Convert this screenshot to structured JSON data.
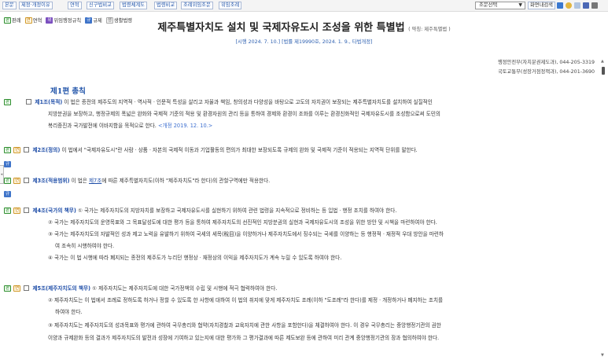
{
  "toolbar": {
    "buttons": [
      "본문",
      "제정·개정이유",
      "연혁",
      "신구법비교",
      "법령체계도",
      "법령비교",
      "조례위임조문",
      "위임조례"
    ],
    "select_value": "조문선택",
    "view_button": "화면내검색",
    "icons": [
      "download-icon",
      "bookmark-icon",
      "print-preview-icon",
      "save-icon",
      "print-icon"
    ],
    "colors": {
      "button_text": "#2255aa",
      "button_border": "#a9b9d6"
    }
  },
  "legend": {
    "items": [
      {
        "badge": "판",
        "label": "판례",
        "icon": "precedent-badge"
      },
      {
        "badge": "연",
        "label": "연혁",
        "icon": "history-badge"
      },
      {
        "badge": "위",
        "label": "위임행정규칙",
        "icon": "delegated-rule-badge"
      },
      {
        "badge": "규",
        "label": "규제",
        "icon": "regulation-badge"
      },
      {
        "badge": "생",
        "label": "생활법령",
        "icon": "living-law-badge"
      }
    ]
  },
  "law": {
    "title": "제주특별자치도 설치 및 국제자유도시 조성을 위한 특별법",
    "short_title": "( 약칭: 제주특별법 )",
    "enforcement": "[시행 2024. 7. 10.] [법률 제19990호, 2024. 1. 9., 타법개정]",
    "ministries": [
      "행정안전부(자치분권제도과), 044-205-3319",
      "국토교통부(성장거점정책과), 044-201-3690"
    ],
    "part": "제1편 총칙"
  },
  "articles": {
    "a1": {
      "head": "제1조(목적)",
      "text1": "이 법은 종전의 제주도의 지역적ㆍ역사적ㆍ인문적 특성을 살리고 자율과 책임, 창의성과 다양성을 바탕으로 고도의 자치권이 보장되는 제주특별자치도를 설치하여 실질적인",
      "text2": "지방분권을 보장하고, 행정규제의 폭넓은 완화와 국제적 기준의 적용 및 환경자원의 관리 등을 통하여 경제와 환경이 조화를 이루는 환경친화적인 국제자유도시를 조성함으로써 도민의",
      "text3": "복리증진과 국가발전에 이바지함을 목적으로 한다.",
      "amend": "<개정 2019. 12. 10.>"
    },
    "a2": {
      "head": "제2조(정의)",
      "text": "이 법에서 \"국제자유도시\"란 사람ㆍ상품ㆍ자본의 국제적 이동과 기업활동의 편의가 최대한 보장되도록 규제의 완화 및 국제적 기준이 적용되는 지역적 단위를 말한다."
    },
    "a3": {
      "head": "제3조(적용범위)",
      "text_a": "이 법은",
      "link": "제7조",
      "text_b": "에 따른 제주특별자치도(이하 \"제주자치도\"라 한다)의 관할구역에만 적용한다."
    },
    "a4": {
      "head": "제4조(국가의 책무)",
      "p1": "① 국가는 제주자치도의 지방자치를 보장하고 국제자유도시를 실현하기 위하여 관련 법령을 지속적으로 정비하는 등 입법ㆍ행정 조치를 하여야 한다.",
      "p2": "② 국가는 제주자치도의 운영목표와 그 목표달성도에 대한 평가 등을 통하여 제주자치도의 선진적인 지방분권의 실현과 국제자유도시의 조성을 위한 방안 및 시책을 마련하여야 한다.",
      "p3a": "③ 국가는 제주자치도의 자발적인 성과 제고 노력을 유발하기 위하여 국세의 세목(稅目)을 이양하거나 제주자치도에서 징수되는 국세를 이양하는 등 행정적ㆍ재정적 우대 방안을 마련하",
      "p3b": "여 조속히 시행하여야 한다.",
      "p4": "④ 국가는 이 법 시행에 따라 폐지되는 종전의 제주도가 누리던 행정상ㆍ재정상의 이익을 제주자치도가 계속 누릴 수 있도록 하여야 한다."
    },
    "a5": {
      "head": "제5조(제주자치도의 책무)",
      "p1": "① 제주자치도는 제주자치도에 대한 국가정책의 수립 및 시행에 적극 협력하여야 한다.",
      "p2a": "② 제주자치도는 이 법에서 조례로 정하도록 하거나 정할 수 있도록 한 사항에 대하여 이 법의 취지에 맞게 제주자치도 조례(이하 \"도조례\"라 한다)를 제정ㆍ개정하거나 폐지하는 조치를",
      "p2b": "하여야 한다.",
      "p3a": "③ 제주자치도는 제주자치도의 성과목표와 평가에 관하여 국무총리와 협약(자치경찰과 교육자치에 관한 사항을 포함한다)을 체결하여야 한다. 이 경우 국무총리는 중앙행정기관의 권한",
      "p3b": "이양과 규제완화 등의 결과가 제주자치도의 발전과 성장에 기여하고 있는지에 대한 평가와 그 평가결과에 따른 제도보완 등에 관하여 미리 관계 중앙행정기관의 장과 협의하여야 한다."
    }
  },
  "badges": {
    "pan": "판",
    "yeon": "연",
    "gyu": "규"
  }
}
